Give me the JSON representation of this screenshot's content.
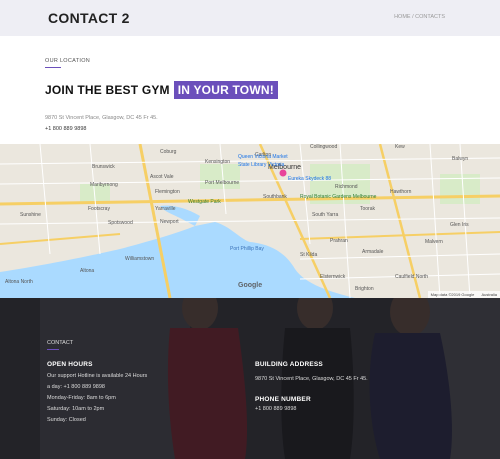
{
  "header": {
    "title": "CONTACT 2",
    "breadcrumb_home": "HOME",
    "breadcrumb_sep": " / ",
    "breadcrumb_current": "CONTACTS"
  },
  "intro": {
    "label": "OUR LOCATION",
    "headline_plain": "JOIN THE BEST GYM",
    "headline_highlight": "IN YOUR TOWN!",
    "address": "9870 St Vincent Place, Glasgow, DC 45 Fr 45.",
    "phone": "+1 800 889 9898"
  },
  "map": {
    "city": "Melbourne",
    "places": [
      "Brunswick",
      "Coburg",
      "Collingwood",
      "Kew",
      "Balwyn",
      "Footscray",
      "Yarraville",
      "Williamstown",
      "Port Melbourne",
      "Carlton",
      "Richmond",
      "Hawthorn",
      "Toorak",
      "South Yarra",
      "St Kilda",
      "Prahran",
      "Elsternwick",
      "Caulfield North",
      "Altona",
      "Altona North",
      "Newport",
      "Spotswood",
      "Kensington",
      "Flemington",
      "Southbank",
      "Malvern",
      "Armadale",
      "Brighton",
      "Sunshine",
      "Maribyrnong",
      "Ascot Vale",
      "Glen Iris"
    ],
    "poi": [
      "Queen Victoria Market",
      "State Library Victoria",
      "Eureka Skydeck 88",
      "Royal Botanic Gardens Melbourne",
      "Westgate Park",
      "Port Phillip Bay"
    ],
    "logo": "Google",
    "footer_left": "Map data ©2019 Google",
    "footer_right": "Australia"
  },
  "footer": {
    "label": "CONTACT",
    "hours_title": "OPEN HOURS",
    "hours_lines": [
      "Our support Hotline is available 24 Hours",
      "a day: +1 800 889 9898",
      "Monday-Friday: 8am to 6pm",
      "Saturday: 10am to 2pm",
      "Sunday: Closed"
    ],
    "address_title": "BUILDING ADDRESS",
    "address_text": "9870 St Vincent Place, Glasgow, DC 45 Fr 45.",
    "phone_title": "PHONE NUMBER",
    "phone_text": "+1 800 889 9898"
  },
  "colors": {
    "accent": "#6b4fbb",
    "header_bg": "#eeeef4",
    "water": "#aadaff",
    "footer_bg": "#2f2f33"
  }
}
